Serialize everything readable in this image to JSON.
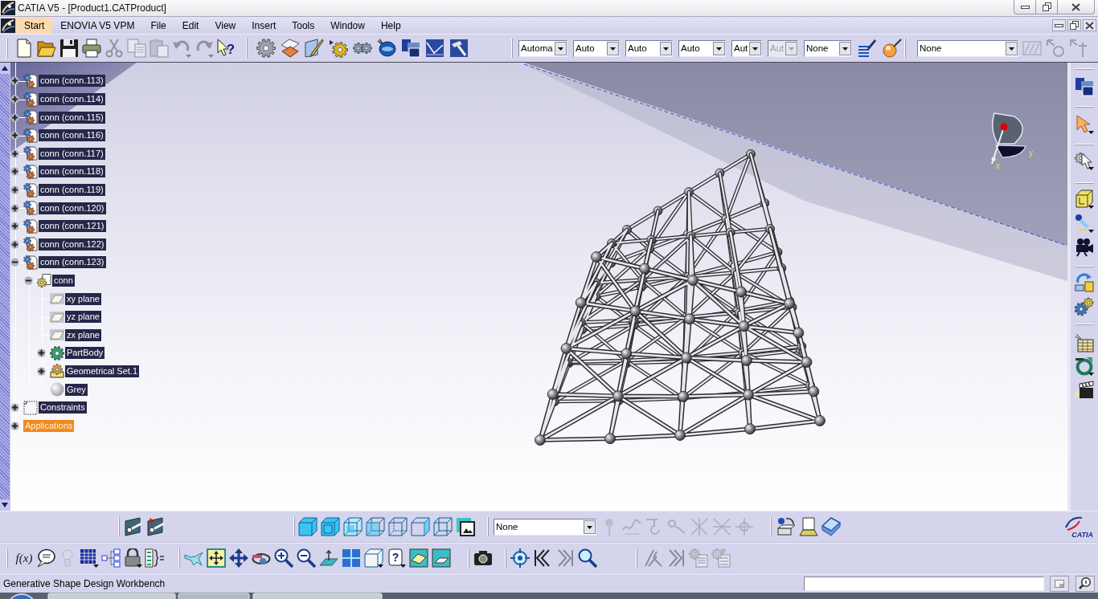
{
  "window": {
    "title": "CATIA V5 - [Product1.CATProduct]"
  },
  "menu_bar": {
    "items": [
      {
        "label": "Start",
        "selected": true
      },
      {
        "label": "ENOVIA V5 VPM",
        "selected": false
      },
      {
        "label": "File",
        "selected": false
      },
      {
        "label": "Edit",
        "selected": false
      },
      {
        "label": "View",
        "selected": false
      },
      {
        "label": "Insert",
        "selected": false
      },
      {
        "label": "Tools",
        "selected": false
      },
      {
        "label": "Window",
        "selected": false
      },
      {
        "label": "Help",
        "selected": false
      }
    ]
  },
  "top_toolbar": {
    "groups": [
      [
        {
          "kind": "button",
          "disabled": false
        },
        {
          "kind": "button",
          "disabled": false
        },
        {
          "kind": "button",
          "disabled": false
        },
        {
          "kind": "button",
          "disabled": false
        },
        {
          "kind": "button",
          "disabled": true
        },
        {
          "kind": "button",
          "disabled": true
        },
        {
          "kind": "button",
          "disabled": true
        },
        {
          "kind": "button",
          "disabled": true
        },
        {
          "kind": "button",
          "disabled": true
        },
        {
          "kind": "button",
          "glyph": "?",
          "disabled": false
        }
      ],
      [
        {
          "kind": "button",
          "disabled": false
        },
        {
          "kind": "button",
          "disabled": false
        },
        {
          "kind": "button",
          "disabled": false
        },
        {
          "kind": "button",
          "disabled": false
        },
        {
          "kind": "button",
          "disabled": false
        },
        {
          "kind": "button",
          "disabled": false
        },
        {
          "kind": "button",
          "disabled": false
        },
        {
          "kind": "button",
          "disabled": false
        },
        {
          "kind": "button",
          "disabled": false
        }
      ],
      [
        {
          "kind": "combo",
          "value": "Automa",
          "disabled": false
        },
        {
          "kind": "combo",
          "value": "Auto",
          "disabled": false
        },
        {
          "kind": "combo",
          "value": "Auto",
          "disabled": false
        },
        {
          "kind": "combo",
          "value": "Auto",
          "disabled": false
        },
        {
          "kind": "combo",
          "value": "Aut",
          "disabled": false
        },
        {
          "kind": "combo",
          "value": "Aut",
          "disabled": true
        },
        {
          "kind": "combo",
          "value": "None",
          "disabled": false
        },
        {
          "kind": "button",
          "disabled": false
        },
        {
          "kind": "button",
          "disabled": false
        }
      ],
      [
        {
          "kind": "combo",
          "value": "None",
          "disabled": false
        },
        {
          "kind": "button",
          "disabled": true
        },
        {
          "kind": "button",
          "disabled": true
        },
        {
          "kind": "button",
          "disabled": true
        }
      ]
    ]
  },
  "tree": {
    "items": [
      {
        "label": "conn (conn.113)",
        "kind": "product",
        "expanded": false,
        "selected": false
      },
      {
        "label": "conn (conn.114)",
        "kind": "product",
        "expanded": false,
        "selected": false
      },
      {
        "label": "conn (conn.115)",
        "kind": "product",
        "expanded": false,
        "selected": false
      },
      {
        "label": "conn (conn.116)",
        "kind": "product",
        "expanded": false,
        "selected": false
      },
      {
        "label": "conn (conn.117)",
        "kind": "product",
        "expanded": false,
        "selected": false
      },
      {
        "label": "conn (conn.118)",
        "kind": "product",
        "expanded": false,
        "selected": false
      },
      {
        "label": "conn (conn.119)",
        "kind": "product",
        "expanded": false,
        "selected": false
      },
      {
        "label": "conn (conn.120)",
        "kind": "product",
        "expanded": false,
        "selected": false
      },
      {
        "label": "conn (conn.121)",
        "kind": "product",
        "expanded": false,
        "selected": false
      },
      {
        "label": "conn (conn.122)",
        "kind": "product",
        "expanded": false,
        "selected": false
      },
      {
        "label": "conn (conn.123)",
        "kind": "product",
        "expanded": true,
        "selected": false,
        "children": [
          {
            "label": "conn",
            "kind": "part",
            "expanded": true,
            "selected": false,
            "children": [
              {
                "label": "xy plane",
                "kind": "plane",
                "selected": false
              },
              {
                "label": "yz plane",
                "kind": "plane",
                "selected": false
              },
              {
                "label": "zx plane",
                "kind": "plane",
                "selected": false
              },
              {
                "label": "PartBody",
                "kind": "body",
                "expanded": false,
                "selected": false
              },
              {
                "label": "Geometrical Set.1",
                "kind": "geometrical_set",
                "expanded": false,
                "selected": false
              },
              {
                "label": "Grey",
                "kind": "material",
                "selected": false
              }
            ]
          }
        ]
      },
      {
        "label": "Constraints",
        "kind": "constraints",
        "expanded": false,
        "selected": false
      },
      {
        "label": "Applications",
        "kind": "applications",
        "expanded": false,
        "selected": true
      }
    ]
  },
  "compass": {
    "x_label": "x",
    "y_label": "y"
  },
  "right_toolbar": {
    "groups": [
      [
        {
          "kind": "button",
          "disabled": false
        }
      ],
      [
        {
          "kind": "button",
          "disabled": false
        }
      ],
      [
        {
          "kind": "button",
          "disabled": false
        }
      ],
      [
        {
          "kind": "button",
          "disabled": false
        },
        {
          "kind": "button",
          "disabled": false
        },
        {
          "kind": "button",
          "disabled": false
        }
      ],
      [
        {
          "kind": "button",
          "disabled": false
        },
        {
          "kind": "button",
          "disabled": false
        }
      ],
      [
        {
          "kind": "button",
          "disabled": false
        },
        {
          "kind": "button",
          "disabled": false
        },
        {
          "kind": "button",
          "disabled": false
        }
      ]
    ]
  },
  "view_toolbar": {
    "groups": [
      [
        {
          "kind": "button",
          "disabled": false
        },
        {
          "kind": "button",
          "disabled": false
        }
      ],
      [
        {
          "kind": "button",
          "disabled": false
        },
        {
          "kind": "button",
          "disabled": false
        },
        {
          "kind": "button",
          "disabled": false
        },
        {
          "kind": "button",
          "disabled": false
        },
        {
          "kind": "button",
          "disabled": false
        },
        {
          "kind": "button",
          "disabled": false
        },
        {
          "kind": "button",
          "disabled": false
        },
        {
          "kind": "button",
          "disabled": false
        }
      ],
      [
        {
          "kind": "combo",
          "value": "None",
          "disabled": false
        },
        {
          "kind": "button",
          "disabled": true
        },
        {
          "kind": "button",
          "disabled": true
        },
        {
          "kind": "button",
          "disabled": true
        },
        {
          "kind": "button",
          "disabled": true
        },
        {
          "kind": "button",
          "disabled": true
        },
        {
          "kind": "button",
          "disabled": true
        },
        {
          "kind": "button",
          "disabled": true
        }
      ],
      [
        {
          "kind": "button",
          "disabled": false
        },
        {
          "kind": "button",
          "disabled": false
        },
        {
          "kind": "button",
          "disabled": false
        }
      ]
    ]
  },
  "brand": {
    "text": "CATIA"
  },
  "tools_toolbar": {
    "groups": [
      [
        {
          "kind": "button",
          "glyph": "f(x)",
          "disabled": false
        },
        {
          "kind": "button",
          "disabled": false
        },
        {
          "kind": "button",
          "disabled": true
        },
        {
          "kind": "button",
          "disabled": false
        },
        {
          "kind": "button",
          "disabled": false
        },
        {
          "kind": "button",
          "disabled": false
        },
        {
          "kind": "button",
          "disabled": false
        }
      ],
      [
        {
          "kind": "button",
          "disabled": false
        },
        {
          "kind": "button",
          "disabled": false
        },
        {
          "kind": "button",
          "disabled": false
        },
        {
          "kind": "button",
          "disabled": false
        },
        {
          "kind": "button",
          "disabled": false
        },
        {
          "kind": "button",
          "disabled": false
        },
        {
          "kind": "button",
          "disabled": false
        },
        {
          "kind": "button",
          "disabled": false
        },
        {
          "kind": "button",
          "disabled": false
        },
        {
          "kind": "button",
          "glyph": "?",
          "disabled": false
        },
        {
          "kind": "button",
          "disabled": false
        },
        {
          "kind": "button",
          "disabled": false
        }
      ],
      [
        {
          "kind": "button",
          "disabled": false
        }
      ],
      [
        {
          "kind": "button",
          "disabled": false
        },
        {
          "kind": "button",
          "disabled": false
        },
        {
          "kind": "button",
          "disabled": true
        },
        {
          "kind": "button",
          "disabled": false
        }
      ],
      [
        {
          "kind": "button",
          "disabled": true
        },
        {
          "kind": "button",
          "disabled": true
        },
        {
          "kind": "button",
          "disabled": true
        },
        {
          "kind": "button",
          "disabled": true
        }
      ]
    ]
  },
  "status_bar": {
    "message": "Generative Shape Design Workbench"
  }
}
